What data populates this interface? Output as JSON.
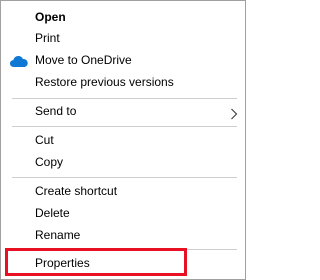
{
  "menu": {
    "items": [
      {
        "label": "Open"
      },
      {
        "label": "Print"
      },
      {
        "label": "Move to OneDrive",
        "icon": "onedrive-cloud-icon"
      },
      {
        "label": "Restore previous versions"
      },
      {
        "label": "Send to",
        "submenu_icon": "chevron-right-icon"
      },
      {
        "label": "Cut"
      },
      {
        "label": "Copy"
      },
      {
        "label": "Create shortcut"
      },
      {
        "label": "Delete"
      },
      {
        "label": "Rename"
      },
      {
        "label": "Properties"
      }
    ],
    "highlight_color": "#e81123",
    "onedrive_color": "#0f78d4"
  }
}
